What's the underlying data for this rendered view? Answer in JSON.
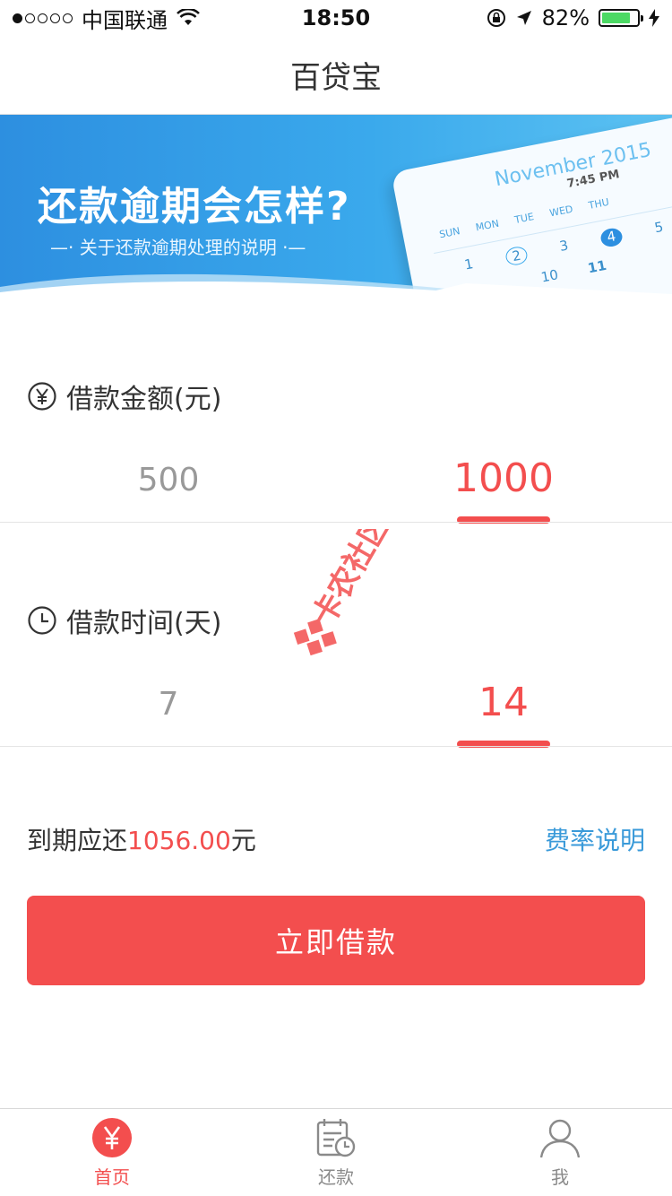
{
  "status_bar": {
    "carrier": "中国联通",
    "time": "18:50",
    "battery": "82%",
    "battery_level": 0.82
  },
  "nav": {
    "title": "百贷宝"
  },
  "banner": {
    "title": "还款逾期会怎样?",
    "subtitle": "—· 关于还款逾期处理的说明 ·—",
    "calendar": {
      "month": "November 2015",
      "time": "7:45 PM",
      "days": [
        "SUN",
        "MON",
        "TUE",
        "WED",
        "THU"
      ],
      "numbers": [
        "1",
        "2",
        "3",
        "4",
        "5"
      ],
      "numbers2": [
        "10",
        "11"
      ]
    }
  },
  "amount": {
    "label": "借款金额(元)",
    "options": [
      "500",
      "1000"
    ],
    "selected_index": 1
  },
  "duration": {
    "label": "借款时间(天)",
    "options": [
      "7",
      "14"
    ],
    "selected_index": 1
  },
  "due": {
    "prefix": "到期应还",
    "amount": "1056.00",
    "suffix": "元",
    "rate_link": "费率说明"
  },
  "borrow_button": "立即借款",
  "watermark": {
    "text": "卡农社区"
  },
  "tabs": [
    {
      "label": "首页",
      "icon": "yuan-icon",
      "active": true
    },
    {
      "label": "还款",
      "icon": "calendar-clock-icon",
      "active": false
    },
    {
      "label": "我",
      "icon": "user-icon",
      "active": false
    }
  ],
  "colors": {
    "accent": "#f34e4e",
    "link": "#3a9ad9",
    "banner": "#2d8fe0"
  }
}
